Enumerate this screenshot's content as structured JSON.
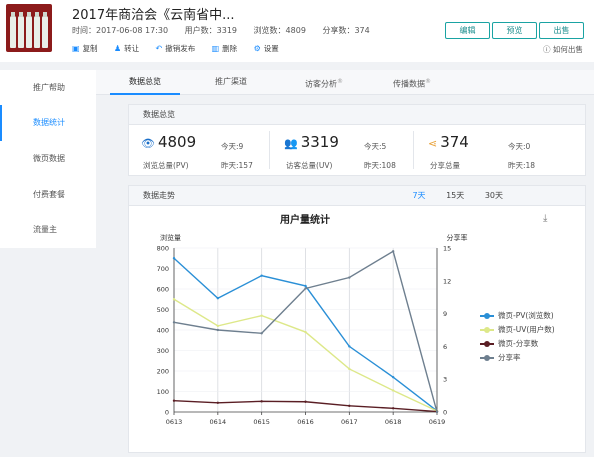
{
  "header": {
    "title": "2017年商洽会《云南省中...",
    "time_label": "时间：2017-06-08 17:30",
    "users_label": "用户数：3319",
    "views_label": "浏览数：4809",
    "shares_label": "分享数：374",
    "actions": [
      {
        "label": "复制",
        "icon": "copy-icon",
        "glyph": "▣"
      },
      {
        "label": "转让",
        "icon": "user-icon",
        "glyph": "♟"
      },
      {
        "label": "撤销发布",
        "icon": "undo-icon",
        "glyph": "↶"
      },
      {
        "label": "删除",
        "icon": "trash-icon",
        "glyph": "▥"
      },
      {
        "label": "设置",
        "icon": "gear-icon",
        "glyph": "⚙"
      }
    ],
    "buttons": {
      "edit": "编辑",
      "preview": "预览",
      "publish": "出售"
    },
    "howto": "如何出售"
  },
  "sidebar": {
    "items": [
      {
        "label": "推广帮助",
        "active": false
      },
      {
        "label": "数据统计",
        "active": true
      },
      {
        "label": "微页数据",
        "active": false
      },
      {
        "label": "付费套餐",
        "active": false
      },
      {
        "label": "流量主",
        "active": false
      }
    ]
  },
  "tabs": [
    {
      "label": "数据总览",
      "active": true,
      "badge": ""
    },
    {
      "label": "推广渠道",
      "active": false,
      "badge": ""
    },
    {
      "label": "访客分析",
      "active": false,
      "badge": "®"
    },
    {
      "label": "传播数据",
      "active": false,
      "badge": "®"
    }
  ],
  "overview": {
    "title": "数据总览",
    "stats": [
      {
        "value": "4809",
        "label": "浏览总量(PV)",
        "today": "今天:9",
        "yesterday": "昨天:157",
        "icon": "eye-icon",
        "glyph": "👁",
        "color": "#1a6fc9"
      },
      {
        "value": "3319",
        "label": "访客总量(UV)",
        "today": "今天:5",
        "yesterday": "昨天:108",
        "icon": "users-icon",
        "glyph": "👥",
        "color": "#3aa84a"
      },
      {
        "value": "374",
        "label": "分享总量",
        "today": "今天:0",
        "yesterday": "昨天:18",
        "icon": "share-icon",
        "glyph": "⋖",
        "color": "#e8a23a"
      }
    ]
  },
  "trend": {
    "title": "数据走势",
    "ranges": [
      {
        "label": "7天",
        "selected": true
      },
      {
        "label": "15天",
        "selected": false
      },
      {
        "label": "30天",
        "selected": false
      }
    ],
    "download_icon": "download-icon"
  },
  "chart_data": {
    "type": "line",
    "title": "用户量统计",
    "x": [
      "0613",
      "0614",
      "0615",
      "0616",
      "0617",
      "0618",
      "0619"
    ],
    "left_axis": {
      "label": "浏览量",
      "min": 0,
      "max": 800,
      "ticks": [
        0,
        100,
        200,
        300,
        400,
        500,
        600,
        700,
        800
      ]
    },
    "right_axis": {
      "label": "分享率",
      "min": 0,
      "max": 15,
      "ticks": [
        0,
        3,
        6,
        9,
        12,
        15
      ]
    },
    "grid": true,
    "legend_position": "right",
    "series": [
      {
        "name": "微页-PV(浏览数)",
        "axis": "left",
        "color": "#2a8fd6",
        "values": [
          750,
          555,
          665,
          615,
          320,
          170,
          5
        ]
      },
      {
        "name": "微页-UV(用户数)",
        "axis": "left",
        "color": "#dde889",
        "values": [
          550,
          420,
          470,
          390,
          210,
          105,
          5
        ]
      },
      {
        "name": "微页-分享数",
        "axis": "left",
        "color": "#5a1e24",
        "values": [
          55,
          45,
          52,
          50,
          30,
          18,
          2
        ]
      },
      {
        "name": "分享率",
        "axis": "right",
        "color": "#6e7f8f",
        "values": [
          8.2,
          7.5,
          7.2,
          11.3,
          12.3,
          14.7,
          0
        ]
      }
    ]
  }
}
